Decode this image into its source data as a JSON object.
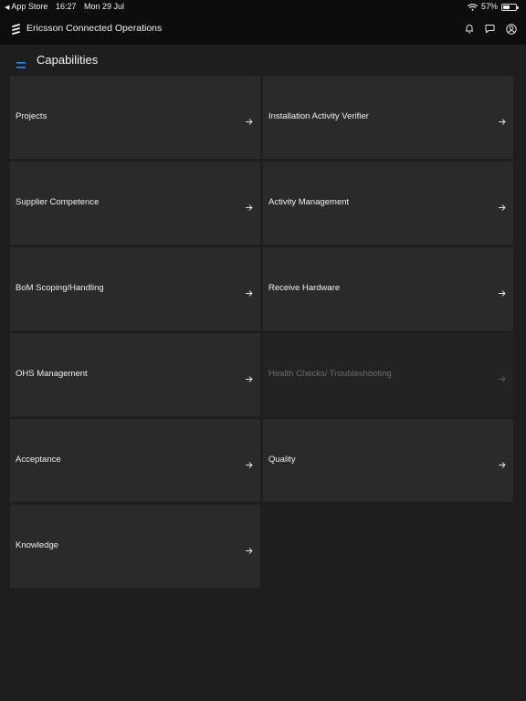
{
  "status_bar": {
    "back_app": "App Store",
    "time": "16:27",
    "date": "Mon 29 Jul",
    "battery_percent_label": "57%",
    "battery_level": 0.57
  },
  "header": {
    "app_title": "Ericsson Connected Operations",
    "icons": [
      "ericsson-logo-icon",
      "bell-icon",
      "chat-icon",
      "user-circle-icon"
    ]
  },
  "page": {
    "title": "Capabilities",
    "accent_color": "#1e90ff"
  },
  "cards": [
    {
      "label": "Projects",
      "disabled": false
    },
    {
      "label": "Installation Activity Verifier",
      "disabled": false
    },
    {
      "label": "Supplier Competence",
      "disabled": false
    },
    {
      "label": "Activity Management",
      "disabled": false
    },
    {
      "label": "BoM Scoping/Handling",
      "disabled": false
    },
    {
      "label": "Receive Hardware",
      "disabled": false
    },
    {
      "label": "OHS Management",
      "disabled": false
    },
    {
      "label": "Health Checks/ Troubleshooting",
      "disabled": true
    },
    {
      "label": "Acceptance",
      "disabled": false
    },
    {
      "label": "Quality",
      "disabled": false
    },
    {
      "label": "Knowledge",
      "disabled": false
    }
  ],
  "card_icon": "arrow-right-icon"
}
